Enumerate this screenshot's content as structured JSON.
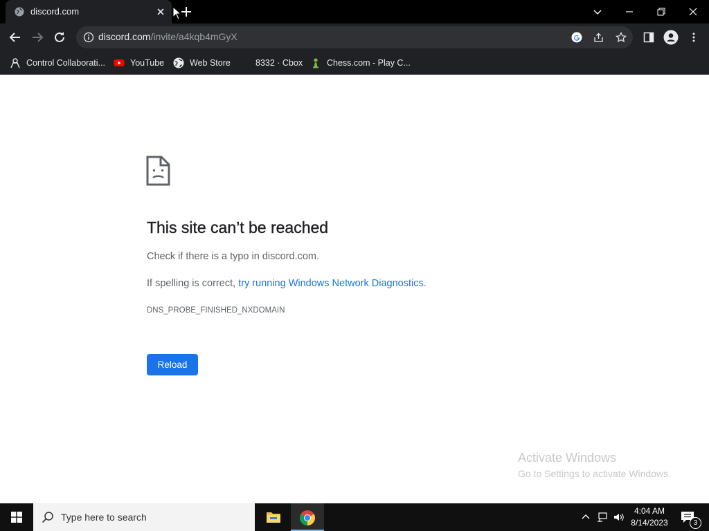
{
  "tab": {
    "title": "discord.com"
  },
  "toolbar": {
    "url_host": "discord.com",
    "url_path": "/invite/a4kqb4mGyX"
  },
  "bookmarks": [
    {
      "label": "Control Collaborati...",
      "icon": "collab-icon"
    },
    {
      "label": "YouTube",
      "icon": "youtube-icon"
    },
    {
      "label": "Web Store",
      "icon": "webstore-icon"
    },
    {
      "label": "8332 · Cbox",
      "icon": "cbox-icon"
    },
    {
      "label": "Chess.com - Play C...",
      "icon": "chess-pawn-icon"
    }
  ],
  "error": {
    "title": "This site can’t be reached",
    "line1": "Check if there is a typo in discord.com.",
    "line2_prefix": "If spelling is correct, ",
    "line2_link": "try running Windows Network Diagnostics",
    "line2_suffix": ".",
    "code": "DNS_PROBE_FINISHED_NXDOMAIN",
    "reload_label": "Reload"
  },
  "watermark": {
    "line1": "Activate Windows",
    "line2": "Go to Settings to activate Windows."
  },
  "taskbar": {
    "search_placeholder": "Type here to search",
    "time": "4:04 AM",
    "date": "8/14/2023",
    "notification_count": "3"
  },
  "colors": {
    "accent": "#1a73e8",
    "chrome_dark": "#202124",
    "titlebar": "#000000",
    "taskbar": "#101010"
  }
}
